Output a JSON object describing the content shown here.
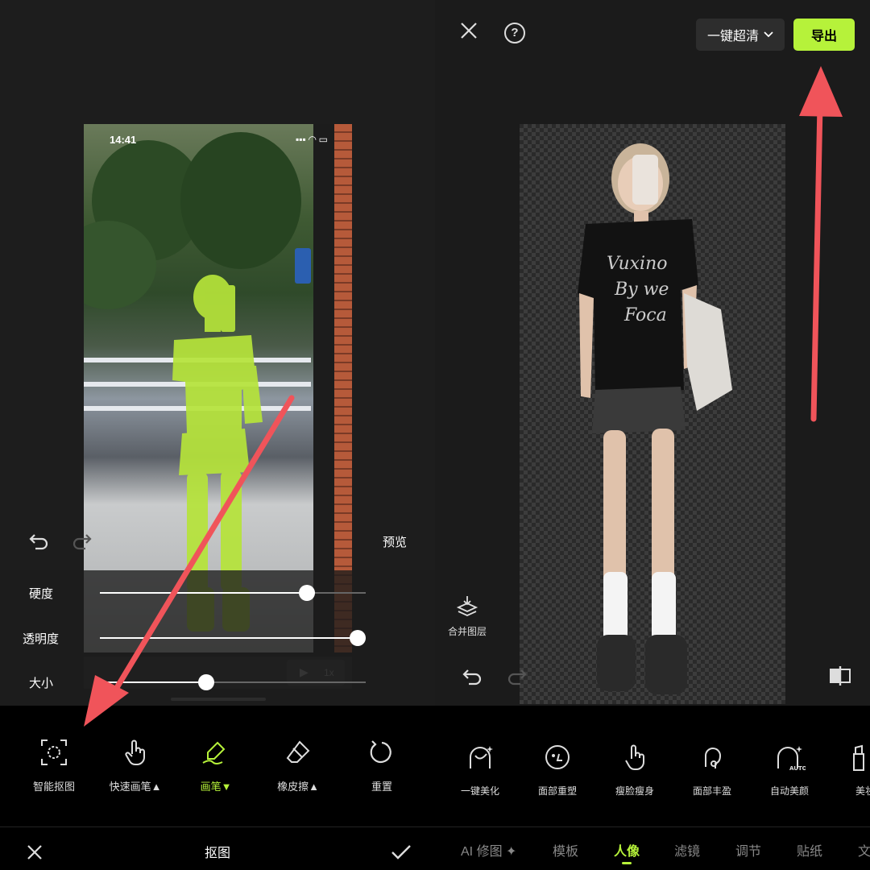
{
  "left": {
    "status_time": "14:41",
    "status_icons": "▪▪▪ ◠ ▭",
    "preview_label": "预览",
    "video_speed": "1x",
    "sliders": [
      {
        "label": "硬度",
        "value": 0.78
      },
      {
        "label": "透明度",
        "value": 0.97
      },
      {
        "label": "大小",
        "value": 0.4
      }
    ],
    "tools": [
      {
        "label": "智能抠图",
        "icon": "smart-cutout-icon"
      },
      {
        "label": "快速画笔▲",
        "icon": "hand-pointer-icon"
      },
      {
        "label": "画笔▼",
        "icon": "brush-icon",
        "active": true
      },
      {
        "label": "橡皮擦▲",
        "icon": "eraser-icon"
      },
      {
        "label": "重置",
        "icon": "reset-icon"
      }
    ],
    "bottom_title": "抠图"
  },
  "right": {
    "quality_label": "一键超清",
    "export_label": "导出",
    "merge_label": "合并图层",
    "tools": [
      {
        "label": "一键美化",
        "icon": "face-beauty-icon"
      },
      {
        "label": "面部重塑",
        "icon": "face-reshape-icon"
      },
      {
        "label": "瘦脸瘦身",
        "icon": "slim-icon"
      },
      {
        "label": "面部丰盈",
        "icon": "face-plump-icon"
      },
      {
        "label": "自动美颜",
        "icon": "auto-beauty-icon"
      },
      {
        "label": "美妆",
        "icon": "makeup-icon"
      }
    ],
    "tabs": [
      {
        "label": "AI 修图 ✦"
      },
      {
        "label": "模板"
      },
      {
        "label": "人像",
        "active": true
      },
      {
        "label": "滤镜"
      },
      {
        "label": "调节"
      },
      {
        "label": "贴纸"
      },
      {
        "label": "文字"
      }
    ]
  },
  "colors": {
    "accent": "#b6f23a",
    "arrow": "#f0545a",
    "mask": "#b6e43a"
  }
}
